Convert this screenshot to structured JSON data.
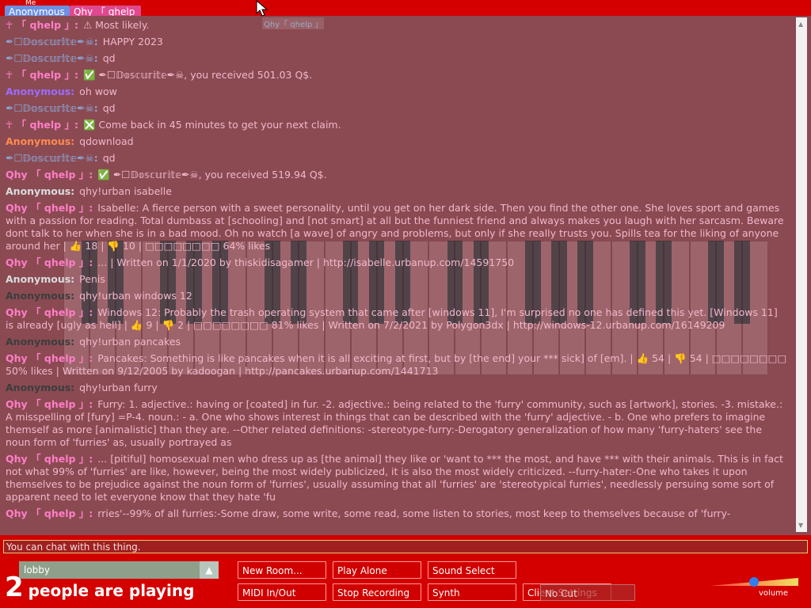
{
  "top": {
    "me_label": "Me",
    "participants": [
      "Anonymous",
      "Qhy 「 qhelp 」"
    ],
    "cursor_label": "Qhy「 qhelp 」"
  },
  "chat": {
    "messages": [
      {
        "nick": "☥ 「 qhelp 」:",
        "text": "⚠ Most likely.",
        "color": "#ff7ec8"
      },
      {
        "nick": "✒☐𝔻𝕠𝕤𝕔𝕦𝕣𝕚𝕥𝕖✒☠:",
        "text": "HAPPY 2023",
        "color": "#8aa4d4"
      },
      {
        "nick": "✒☐𝔻𝕠𝕤𝕔𝕦𝕣𝕚𝕥𝕖✒☠:",
        "text": "qd",
        "color": "#8aa4d4"
      },
      {
        "nick": "☥ 「 qhelp 」:",
        "text": "✅ ✒☐𝔻𝕠𝕤𝕔𝕦𝕣𝕚𝕥𝕖✒☠, you received 501.03 Q$.",
        "color": "#ff7ec8"
      },
      {
        "nick": "Anonymous:",
        "text": "oh wow",
        "color": "#9b6cff"
      },
      {
        "nick": "✒☐𝔻𝕠𝕤𝕔𝕦𝕣𝕚𝕥𝕖✒☠:",
        "text": "qd",
        "color": "#8aa4d4"
      },
      {
        "nick": "☥ 「 qhelp 」:",
        "text": "❎ Come back in 45 minutes to get your next claim.",
        "color": "#ff7ec8"
      },
      {
        "nick": "Anonymous:",
        "text": "qdownload",
        "color": "#ff8a50"
      },
      {
        "nick": "✒☐𝔻𝕠𝕤𝕔𝕦𝕣𝕚𝕥𝕖✒☠:",
        "text": "qd",
        "color": "#8aa4d4"
      },
      {
        "nick": "Qhy 「 qhelp 」:",
        "text": "✅ ✒☐𝔻𝕠𝕤𝕔𝕦𝕣𝕚𝕥𝕖✒☠, you received 519.94 Q$.",
        "color": "#ff7ec8"
      },
      {
        "nick": "Anonymous:",
        "text": "qhy!urban isabelle",
        "color": "#d8dcdc"
      },
      {
        "nick": "Qhy 「 qhelp 」:",
        "text": "Isabelle: A fierce person with a sweet personality, until you get on her dark side. Then you find the other one. She loves sport and games with a passion for reading. Total dumbass at [schooling] and [not smart] at all but the funniest friend and always makes you laugh with her sarcasm. Beware dont talk to her when she is in a bad mood. Oh no watch [a wave] of angry and problems, but only if she really trusts you. Spills tea for the liking of anyone around her | 👍 18 | 👎 10 | □□□□□□□□ 64% likes",
        "color": "#ff7ec8"
      },
      {
        "nick": "Qhy 「 qhelp 」:",
        "text": "... | Written on 1/1/2020 by thiskidisagamer | http://isabelle.urbanup.com/14591750",
        "color": "#ff7ec8"
      },
      {
        "nick": "Anonymous:",
        "text": "Penis",
        "color": "#d8dcdc"
      },
      {
        "nick": "Anonymous:",
        "text": "qhy!urban windows 12",
        "color": "#3a3e3e"
      },
      {
        "nick": "Qhy 「 qhelp 」:",
        "text": "Windows 12: Probably the trash operating system that came after [windows 11], I'm surprised no one has defined this yet. [Windows 11] is already [ugly as hell] | 👍 9 | 👎 2 | □□□□□□□□ 81% likes | Written on 7/2/2021 by Polygon3dx | http://windows-12.urbanup.com/16149209",
        "color": "#ff7ec8"
      },
      {
        "nick": "Anonymous:",
        "text": "qhy!urban pancakes",
        "color": "#3a3e3e"
      },
      {
        "nick": "Qhy 「 qhelp 」:",
        "text": "Pancakes: Something is like pancakes when it is all exciting at first, but by [the end] your *** sick] of [em]. | 👍 54 | 👎 54 | □□□□□□□□ 50% likes | Written on 9/12/2005 by kadoogan | http://pancakes.urbanup.com/1441713",
        "color": "#ff7ec8"
      },
      {
        "nick": "Anonymous:",
        "text": "qhy!urban furry",
        "color": "#3a3e3e"
      },
      {
        "nick": "Qhy 「 qhelp 」:",
        "text": "Furry: 1. adjective.: having or [coated] in fur. -2. adjective.: being related to the 'furry' community, such as [artwork], stories. -3. mistake.: A misspelling of [fury] =P-4. noun.: - a. One who shows interest in things that can be described with the 'furry' adjective. - b. One who prefers to imagine themself as more [animalistic] than they are. --Other related definitions: -stereotype-furry:-Derogatory generalization of how many 'furry-haters' see the noun form of 'furries' as, usually portrayed as",
        "color": "#ff7ec8"
      },
      {
        "nick": "Qhy 「 qhelp 」:",
        "text": "... [pitiful] homosexual men who dress up as [the animal] they like or 'want to *** the most, and have *** with their animals. This is in fact not what 99% of 'furries' are like, however, being the most widely publicized, it is also the most widely criticized. --furry-hater:-One who takes it upon themselves to be prejudice against the noun form of 'furries', usually assuming that all 'furries' are 'stereotypical furries', needlessly persuing some sort of apparent need to let everyone know that they hate 'fu",
        "color": "#ff7ec8"
      },
      {
        "nick": "Qhy 「 qhelp 」:",
        "text": "rries'--99% of all furries:-Some draw, some write, some read, some listen to stories, most keep to themselves because of 'furry-",
        "color": "#ff7ec8"
      }
    ],
    "text_color": "#f0b8cc",
    "input_placeholder": "You can chat with this thing."
  },
  "controls": {
    "room": "lobby",
    "players_count": "2",
    "players_label": "people are playing",
    "buttons": {
      "new_room": "New Room...",
      "play_alone": "Play Alone",
      "sound_select": "Sound Select",
      "midi": "MIDI In/Out",
      "stop_recording": "Stop Recording",
      "synth": "Synth",
      "client_settings": "Client Settings",
      "overlay_label": "No Cut"
    },
    "volume_label": "volume",
    "volume_level": 0.5
  },
  "colors": {
    "top_bar": "#d40000",
    "stage_bg": "#8b4a52",
    "button_bg": "#d00000",
    "anon_tag": "#6d8fe0",
    "qhy_tag": "#e04890"
  },
  "icons": [
    "up-arrow-icon",
    "down-arrow-icon",
    "mouse-cursor-icon"
  ]
}
